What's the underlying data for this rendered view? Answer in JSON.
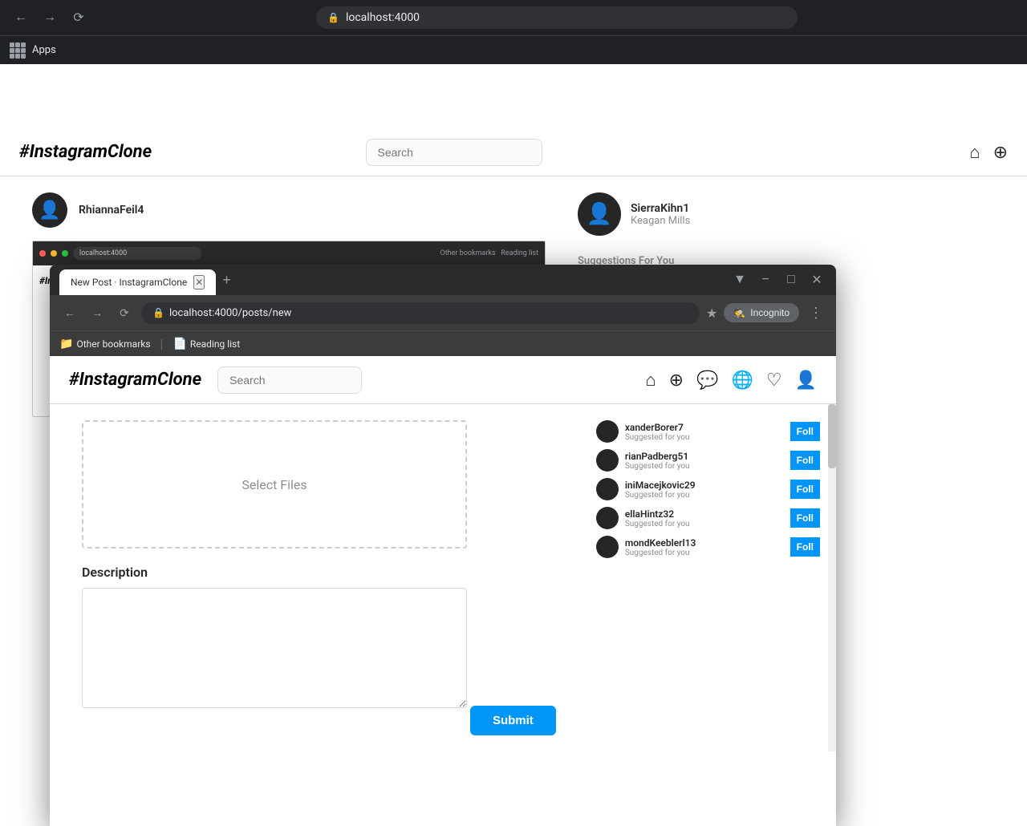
{
  "browser_outer": {
    "url": "localhost:4000",
    "apps_label": "Apps"
  },
  "main_page": {
    "brand": "#InstagramClone",
    "search_placeholder": "Search",
    "user": {
      "username": "RhiannaFeil4",
      "fullname": ""
    },
    "nav_icons": [
      "home",
      "plus-circle",
      "message-circle",
      "globe",
      "heart",
      "person"
    ]
  },
  "sidebar": {
    "user": {
      "username": "SierraKihn1",
      "fullname": "Keagan Mills"
    },
    "suggestions_title": "Suggestions For You",
    "suggestions": [
      {
        "name": "xanderBorer7",
        "sub": "Suggested for you"
      },
      {
        "name": "rianPadberg51",
        "sub": "Suggested for you"
      },
      {
        "name": "iniMacejkovic29",
        "sub": "Suggested for you"
      },
      {
        "name": "ellaHintz32",
        "sub": "Suggested for you"
      },
      {
        "name": "mondKeeblerl13",
        "sub": "Suggested for you"
      }
    ],
    "follow_label": "Foll"
  },
  "popup": {
    "tab_title": "New Post · InstagramClone",
    "url": "localhost:4000/posts/new",
    "incognito_label": "Incognito",
    "bookmarks": [
      {
        "label": "Other bookmarks",
        "icon": "📁"
      },
      {
        "label": "Reading list",
        "icon": "📄"
      }
    ],
    "brand": "#InstagramClone",
    "search_placeholder": "Search",
    "form": {
      "select_files_label": "Select Files",
      "description_label": "Description",
      "description_placeholder": "",
      "submit_label": "Submit"
    }
  }
}
